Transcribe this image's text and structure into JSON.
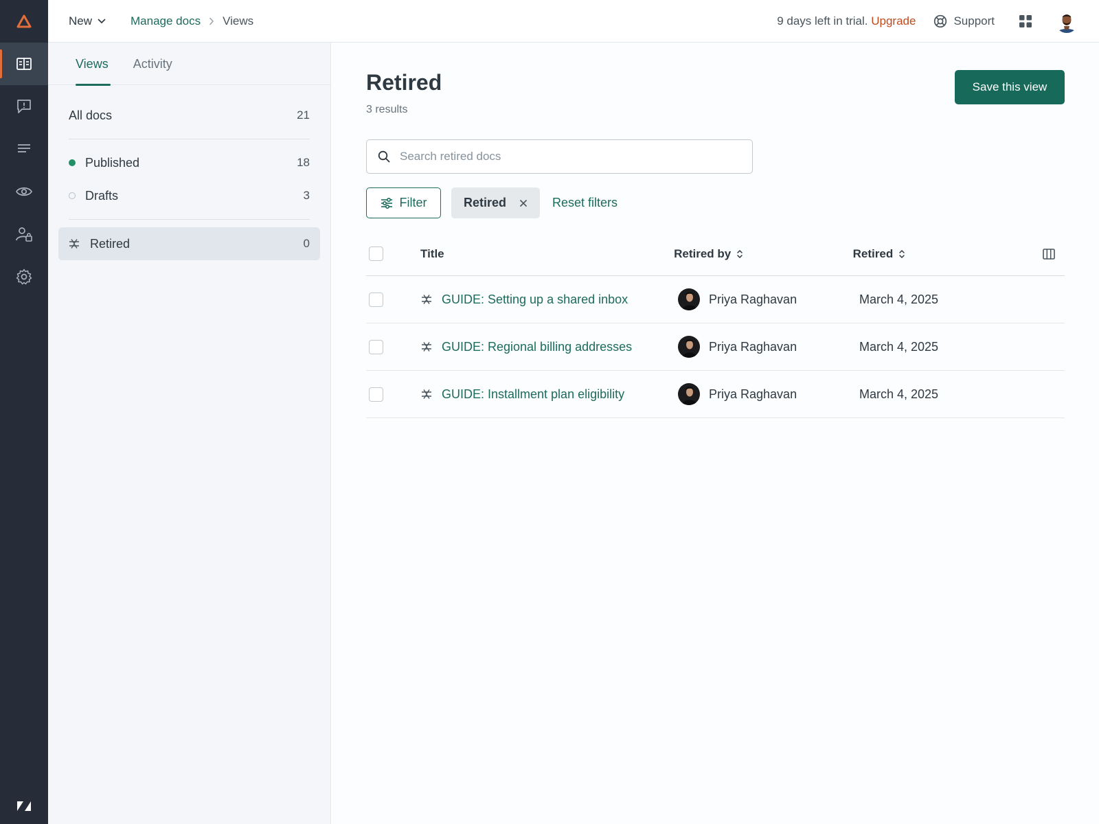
{
  "colors": {
    "accent": "#1c6b5c",
    "rail": "#262d38",
    "upgrade": "#c04a1e",
    "brand": "#e26f3b",
    "published_dot": "#228f67"
  },
  "rail": {
    "items": [
      {
        "icon": "book-icon",
        "active": true
      },
      {
        "icon": "feedback-icon",
        "active": false
      },
      {
        "icon": "list-icon",
        "active": false
      },
      {
        "icon": "eye-icon",
        "active": false
      },
      {
        "icon": "user-lock-icon",
        "active": false
      },
      {
        "icon": "gear-icon",
        "active": false
      }
    ]
  },
  "topbar": {
    "new_label": "New",
    "breadcrumb": {
      "parent": "Manage docs",
      "current": "Views"
    },
    "trial_text": "9 days left in trial.",
    "upgrade_label": "Upgrade",
    "support_label": "Support"
  },
  "views_panel": {
    "tabs": [
      {
        "label": "Views"
      },
      {
        "label": "Activity"
      }
    ],
    "all_docs": {
      "label": "All docs",
      "count": "21"
    },
    "published": {
      "label": "Published",
      "count": "18"
    },
    "drafts": {
      "label": "Drafts",
      "count": "3"
    },
    "retired": {
      "label": "Retired",
      "count": "0"
    }
  },
  "main": {
    "title": "Retired",
    "results": "3 results",
    "save_label": "Save this view",
    "search_placeholder": "Search retired docs",
    "filter_label": "Filter",
    "chip_label": "Retired",
    "reset_label": "Reset filters"
  },
  "table": {
    "headers": {
      "title": "Title",
      "retired_by": "Retired by",
      "retired": "Retired"
    },
    "rows": [
      {
        "title": "GUIDE: Setting up a shared inbox",
        "retired_by": "Priya Raghavan",
        "date": "March 4, 2025"
      },
      {
        "title": "GUIDE: Regional billing addresses",
        "retired_by": "Priya Raghavan",
        "date": "March 4, 2025"
      },
      {
        "title": "GUIDE: Installment plan eligibility",
        "retired_by": "Priya Raghavan",
        "date": "March 4, 2025"
      }
    ]
  }
}
